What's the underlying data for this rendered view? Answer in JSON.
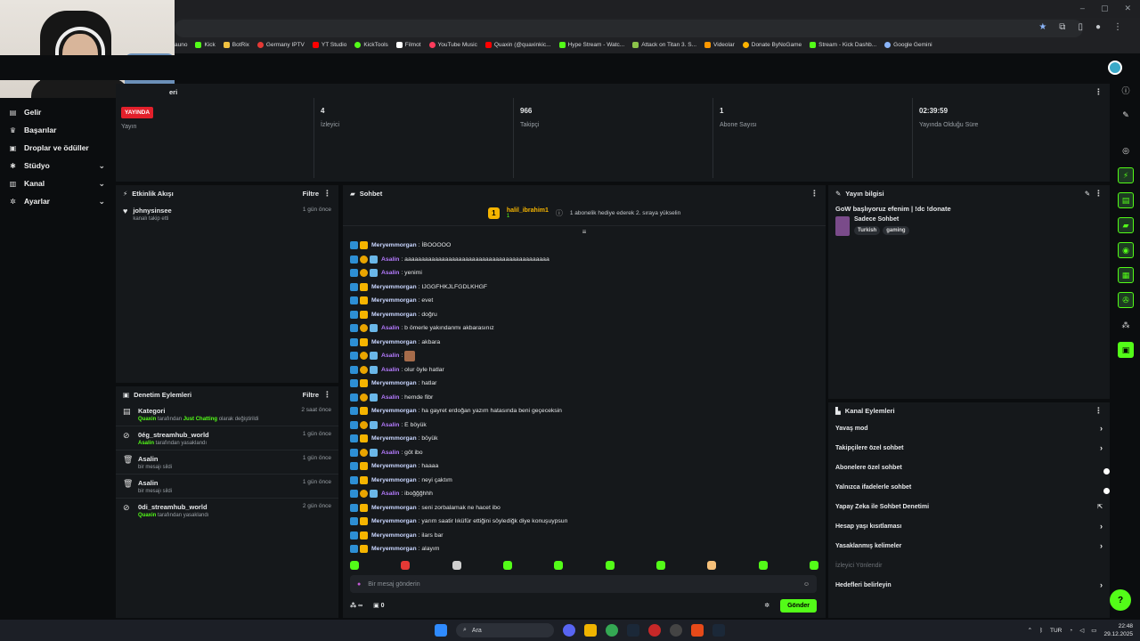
{
  "browser": {
    "bookmarks": [
      "Kick",
      "BotRix",
      "Germany IPTV",
      "YT Studio",
      "KickTools",
      "Filmot",
      "YouTube Music",
      "Quaxin (@quaxinkic...",
      "Hype Stream - Watc...",
      "Attack on Titan 3. S...",
      "Videolar",
      "Donate ByNoGame",
      "Stream - Kick Dashb...",
      "Google Gemini"
    ],
    "bookmark_first_partial": "auno"
  },
  "sidebar": {
    "items": [
      {
        "label": "Gelir",
        "icon": "wallet-icon",
        "expand": false
      },
      {
        "label": "Başarılar",
        "icon": "trophy-icon",
        "expand": false
      },
      {
        "label": "Droplar ve ödüller",
        "icon": "gift-icon",
        "expand": false
      },
      {
        "label": "Stüdyo",
        "icon": "studio-icon",
        "expand": true
      },
      {
        "label": "Kanal",
        "icon": "channel-icon",
        "expand": true
      },
      {
        "label": "Ayarlar",
        "icon": "gear-icon",
        "expand": true
      }
    ]
  },
  "stats": {
    "title_partial": "eri",
    "live_badge": "YAYINDA",
    "items": [
      {
        "value": "",
        "label": "Yayın"
      },
      {
        "value": "4",
        "label": "İzleyici"
      },
      {
        "value": "966",
        "label": "Takipçi"
      },
      {
        "value": "1",
        "label": "Abone Sayısı"
      },
      {
        "value": "02:39:59",
        "label": "Yayında Olduğu Süre"
      }
    ]
  },
  "activity": {
    "title": "Etkinlik Akışı",
    "filter": "Filtre",
    "rows": [
      {
        "name": "johnysinsee",
        "sub": "kanalı takip etti",
        "time": "1 gün önce"
      }
    ]
  },
  "moderation": {
    "title": "Denetim Eylemleri",
    "filter": "Filtre",
    "rows": [
      {
        "name": "Kategori",
        "sub_a": "Quaxin",
        "sub_b": " tarafından ",
        "sub_c": "Just Chatting",
        "sub_d": " olarak değiştirildi",
        "time": "2 saat önce",
        "icon": "category-icon"
      },
      {
        "name": "0ég_streamhub_world",
        "sub_a": "Asalin",
        "sub_b": " tarafından yasaklandı",
        "sub_c": "",
        "sub_d": "",
        "time": "1 gün önce",
        "icon": "ban-icon"
      },
      {
        "name": "Asalin",
        "sub_a": "",
        "sub_b": "bir mesajı sildi",
        "sub_c": "",
        "sub_d": "",
        "time": "1 gün önce",
        "icon": "trash-icon"
      },
      {
        "name": "Asalin",
        "sub_a": "",
        "sub_b": "bir mesajı sildi",
        "sub_c": "",
        "sub_d": "",
        "time": "1 gün önce",
        "icon": "trash-icon"
      },
      {
        "name": "0di_streamhub_world",
        "sub_a": "Quaxin",
        "sub_b": " tarafından yasaklandı",
        "sub_c": "",
        "sub_d": "",
        "time": "2 gün önce",
        "icon": "ban-icon"
      }
    ]
  },
  "chat": {
    "title": "Sohbet",
    "pinned": {
      "name": "halil_ibrahim1",
      "count": "1",
      "message": "1 abonelik hediye ederek 2. sıraya yükselin"
    },
    "messages": [
      {
        "user": "Meryemmorgan",
        "text": ": İBOOOOO",
        "who": "mery"
      },
      {
        "user": "Asalin",
        "text": ": aaaaaaaaaaaaaaaaaaaaaaaaaaaaaaaaaaaaaaaaaaa",
        "who": "asa"
      },
      {
        "user": "Asalin",
        "text": ": yenimi",
        "who": "asa"
      },
      {
        "user": "Meryemmorgan",
        "text": ": IJGGFHKJLFGDLKHGF",
        "who": "mery"
      },
      {
        "user": "Meryemmorgan",
        "text": ": evet",
        "who": "mery"
      },
      {
        "user": "Meryemmorgan",
        "text": ": doğru",
        "who": "mery"
      },
      {
        "user": "Asalin",
        "text": ": b ömerle yakındanmı akbarasınız",
        "who": "asa"
      },
      {
        "user": "Meryemmorgan",
        "text": ": akbara",
        "who": "mery"
      },
      {
        "user": "Asalin",
        "text": ":",
        "who": "asa",
        "emoji": true
      },
      {
        "user": "Asalin",
        "text": ": olur öyle hatlar",
        "who": "asa"
      },
      {
        "user": "Meryemmorgan",
        "text": ": hatlar",
        "who": "mery"
      },
      {
        "user": "Asalin",
        "text": ": hemde fibr",
        "who": "asa"
      },
      {
        "user": "Meryemmorgan",
        "text": ": ha gayret erdoğan yazım hatasında beni geçeceksin",
        "who": "mery"
      },
      {
        "user": "Asalin",
        "text": ": E böyük",
        "who": "asa"
      },
      {
        "user": "Meryemmorgan",
        "text": ": böyük",
        "who": "mery"
      },
      {
        "user": "Asalin",
        "text": ": göt ibo",
        "who": "asa"
      },
      {
        "user": "Meryemmorgan",
        "text": ": haaaa",
        "who": "mery"
      },
      {
        "user": "Meryemmorgan",
        "text": ": neyi çaktım",
        "who": "mery"
      },
      {
        "user": "Asalin",
        "text": ": iboğğğhhh",
        "who": "asa"
      },
      {
        "user": "Meryemmorgan",
        "text": ": seni zorbalamak ne hacet ibo",
        "who": "mery"
      },
      {
        "user": "Meryemmorgan",
        "text": ": yarım saatir lıküfür ettiğini söylediğk diye konuşuypsun",
        "who": "mery"
      },
      {
        "user": "Meryemmorgan",
        "text": ": ilars bar",
        "who": "mery"
      },
      {
        "user": "Meryemmorgan",
        "text": ": alayım",
        "who": "mery"
      }
    ],
    "input_placeholder": "Bir mesaj gönderin",
    "infinity": "∞",
    "gift_count": "0",
    "send": "Gönder"
  },
  "stream_info": {
    "title": "Yayın bilgisi",
    "stream_title": "GoW başlıyoruz efenim | !dc !donate",
    "category": "Sadece Sohbet",
    "tags": [
      "Turkish",
      "gaming"
    ]
  },
  "channel_actions": {
    "title": "Kanal Eylemleri",
    "rows": [
      {
        "label": "Yavaş mod",
        "control": "arrow"
      },
      {
        "label": "Takipçilere özel sohbet",
        "control": "arrow"
      },
      {
        "label": "Abonelere özel sohbet",
        "control": "toggle"
      },
      {
        "label": "Yalnızca ifadelerle sohbet",
        "control": "toggle"
      },
      {
        "label": "Yapay Zeka ile Sohbet Denetimi",
        "control": "external"
      },
      {
        "label": "Hesap yaşı kısıtlaması",
        "control": "arrow"
      },
      {
        "label": "Yasaklanmış kelimeler",
        "control": "arrow"
      },
      {
        "label": "İzleyici Yönlendir",
        "control": "none",
        "dim": true
      },
      {
        "label": "Hedefleri belirleyin",
        "control": "arrow"
      }
    ]
  },
  "taskbar": {
    "search": "Ara",
    "lang": "TUR",
    "time": "22:48",
    "date": "29.12.2025"
  },
  "colors": {
    "accent": "#53fc18",
    "live": "#e3202b",
    "panel": "#15181b",
    "asalin": "#b57bff",
    "pinned": "#f5b400"
  }
}
